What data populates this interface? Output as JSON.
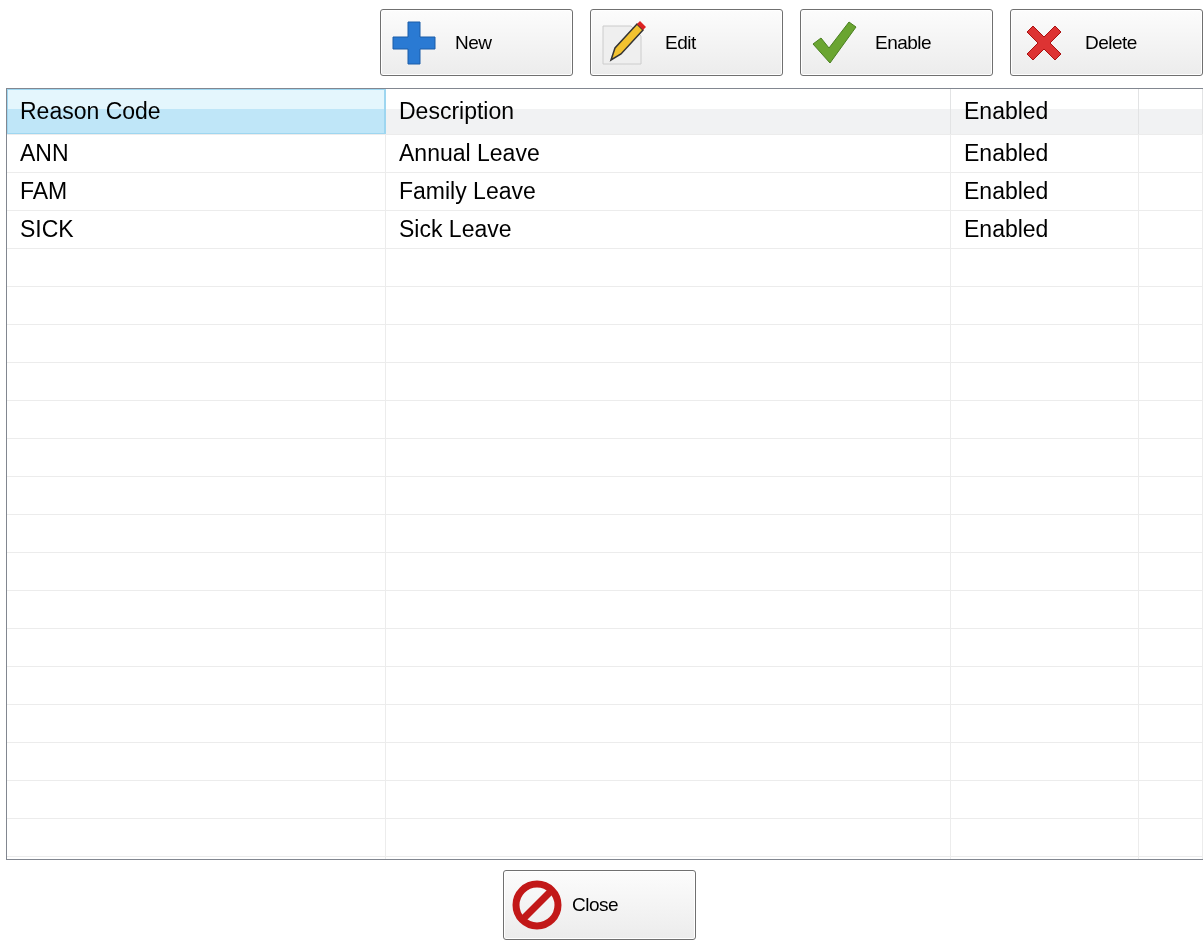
{
  "toolbar": [
    {
      "kind": "new",
      "label": "New"
    },
    {
      "kind": "edit",
      "label": "Edit"
    },
    {
      "kind": "enable",
      "label": "Enable"
    },
    {
      "kind": "delete",
      "label": "Delete"
    }
  ],
  "table": {
    "columns": [
      {
        "label": "Reason Code",
        "selected": true
      },
      {
        "label": "Description",
        "selected": false
      },
      {
        "label": "Enabled",
        "selected": false
      }
    ],
    "rows": [
      [
        "ANN",
        "Annual Leave",
        "Enabled"
      ],
      [
        "FAM",
        "Family Leave",
        "Enabled"
      ],
      [
        "SICK",
        "Sick Leave",
        "Enabled"
      ]
    ]
  },
  "close_button": {
    "label": "Close"
  }
}
